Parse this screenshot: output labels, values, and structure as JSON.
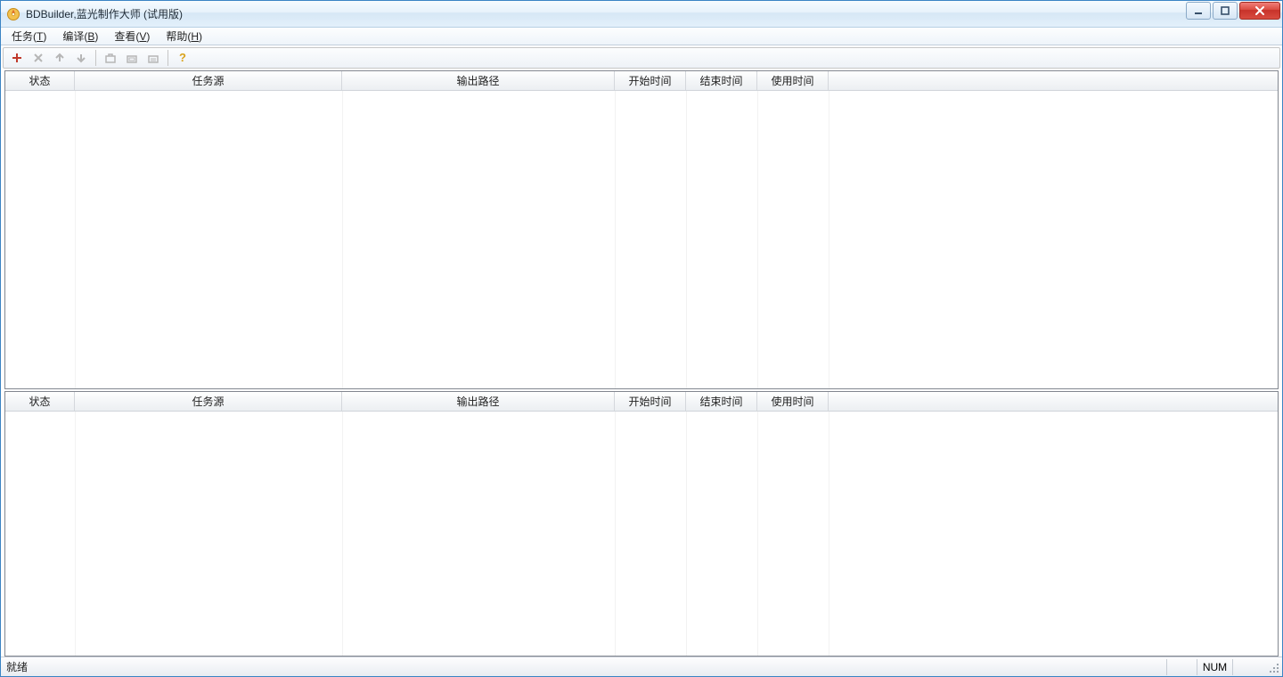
{
  "window": {
    "title": "BDBuilder,蓝光制作大师 (试用版)"
  },
  "menus": {
    "task": {
      "pre": "任务(",
      "hot": "T",
      "post": ")"
    },
    "compile": {
      "pre": "编译(",
      "hot": "B",
      "post": ")"
    },
    "view": {
      "pre": "查看(",
      "hot": "V",
      "post": ")"
    },
    "help": {
      "pre": "帮助(",
      "hot": "H",
      "post": ")"
    }
  },
  "columns": {
    "status": "状态",
    "source": "任务源",
    "output": "输出路径",
    "start": "开始时间",
    "end": "结束时间",
    "used": "使用时间"
  },
  "statusbar": {
    "ready": "就绪",
    "num": "NUM"
  }
}
